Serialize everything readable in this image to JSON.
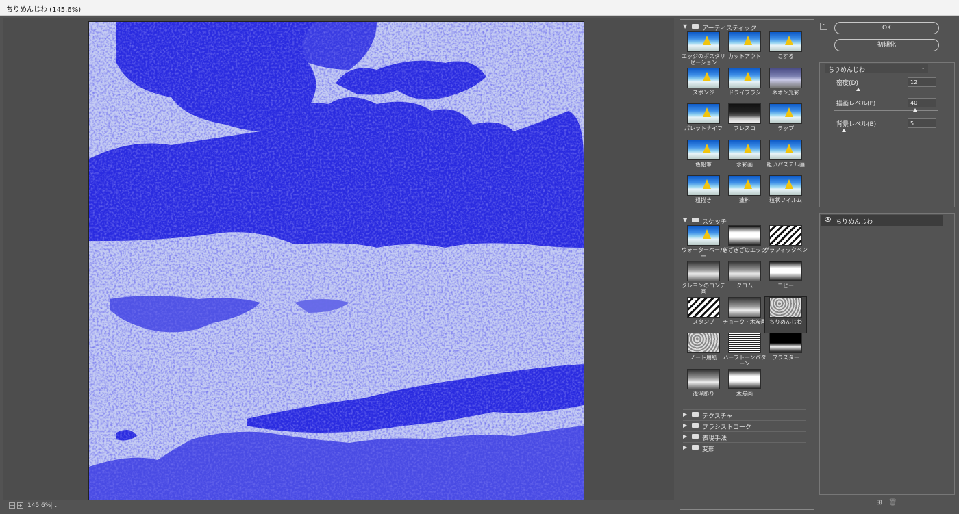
{
  "window": {
    "title": "ちりめんじわ (145.6%)"
  },
  "status": {
    "zoom": "145.6%",
    "zoom_out": "−",
    "zoom_in": "+",
    "dropdown": "⌄"
  },
  "gallery": {
    "categories_open": [
      {
        "name": "アーティスティック",
        "items": [
          {
            "label": "エッジのポスタリゼーション",
            "style": "color"
          },
          {
            "label": "カットアウト",
            "style": "color"
          },
          {
            "label": "こする",
            "style": "color"
          },
          {
            "label": "スポンジ",
            "style": "color"
          },
          {
            "label": "ドライブラシ",
            "style": "color"
          },
          {
            "label": "ネオン光彩",
            "style": "neon"
          },
          {
            "label": "パレットナイフ",
            "style": "color"
          },
          {
            "label": "フレスコ",
            "style": "dark"
          },
          {
            "label": "ラップ",
            "style": "color"
          },
          {
            "label": "色鉛筆",
            "style": "color"
          },
          {
            "label": "水彩画",
            "style": "color"
          },
          {
            "label": "粗いパステル画",
            "style": "color"
          },
          {
            "label": "粗描き",
            "style": "color"
          },
          {
            "label": "塗料",
            "style": "color"
          },
          {
            "label": "粒状フィルム",
            "style": "color"
          }
        ]
      },
      {
        "name": "スケッチ",
        "items": [
          {
            "label": "ウォーターペーパー",
            "style": "color"
          },
          {
            "label": "ぎざぎざのエッジ",
            "style": "bw2"
          },
          {
            "label": "グラフィックペン",
            "style": "bw"
          },
          {
            "label": "クレヨンのコンテ画",
            "style": "gray"
          },
          {
            "label": "クロム",
            "style": "gray"
          },
          {
            "label": "コピー",
            "style": "bw2"
          },
          {
            "label": "スタンプ",
            "style": "bw"
          },
          {
            "label": "チョーク・木炭画",
            "style": "gray"
          },
          {
            "label": "ちりめんじわ",
            "style": "gray2"
          },
          {
            "label": "ノート用紙",
            "style": "gray2"
          },
          {
            "label": "ハーフトーンパターン",
            "style": "halftone"
          },
          {
            "label": "プラスター",
            "style": "blackish"
          },
          {
            "label": "浅浮彫り",
            "style": "gray"
          },
          {
            "label": "木炭画",
            "style": "bw2"
          }
        ]
      }
    ],
    "selected": "ちりめんじわ",
    "categories_closed": [
      "テクスチャ",
      "ブラシストローク",
      "表現手法",
      "変形"
    ],
    "arrow_open": "▼",
    "arrow_closed": "▶"
  },
  "dialog": {
    "collapse_glyph": "⌃",
    "ok_label": "OK",
    "reset_label": "初期化",
    "filter_select": "ちりめんじわ",
    "chevron": "⌄",
    "params": [
      {
        "label": "密度(D)",
        "value": "12",
        "level": 0.24
      },
      {
        "label": "描画レベル(F)",
        "value": "40",
        "level": 0.78
      },
      {
        "label": "背景レベル(B)",
        "value": "5",
        "level": 0.1
      }
    ]
  },
  "layers": {
    "items": [
      {
        "name": "ちりめんじわ"
      }
    ],
    "new_glyph": "⊞",
    "delete_glyph": "🗑"
  }
}
